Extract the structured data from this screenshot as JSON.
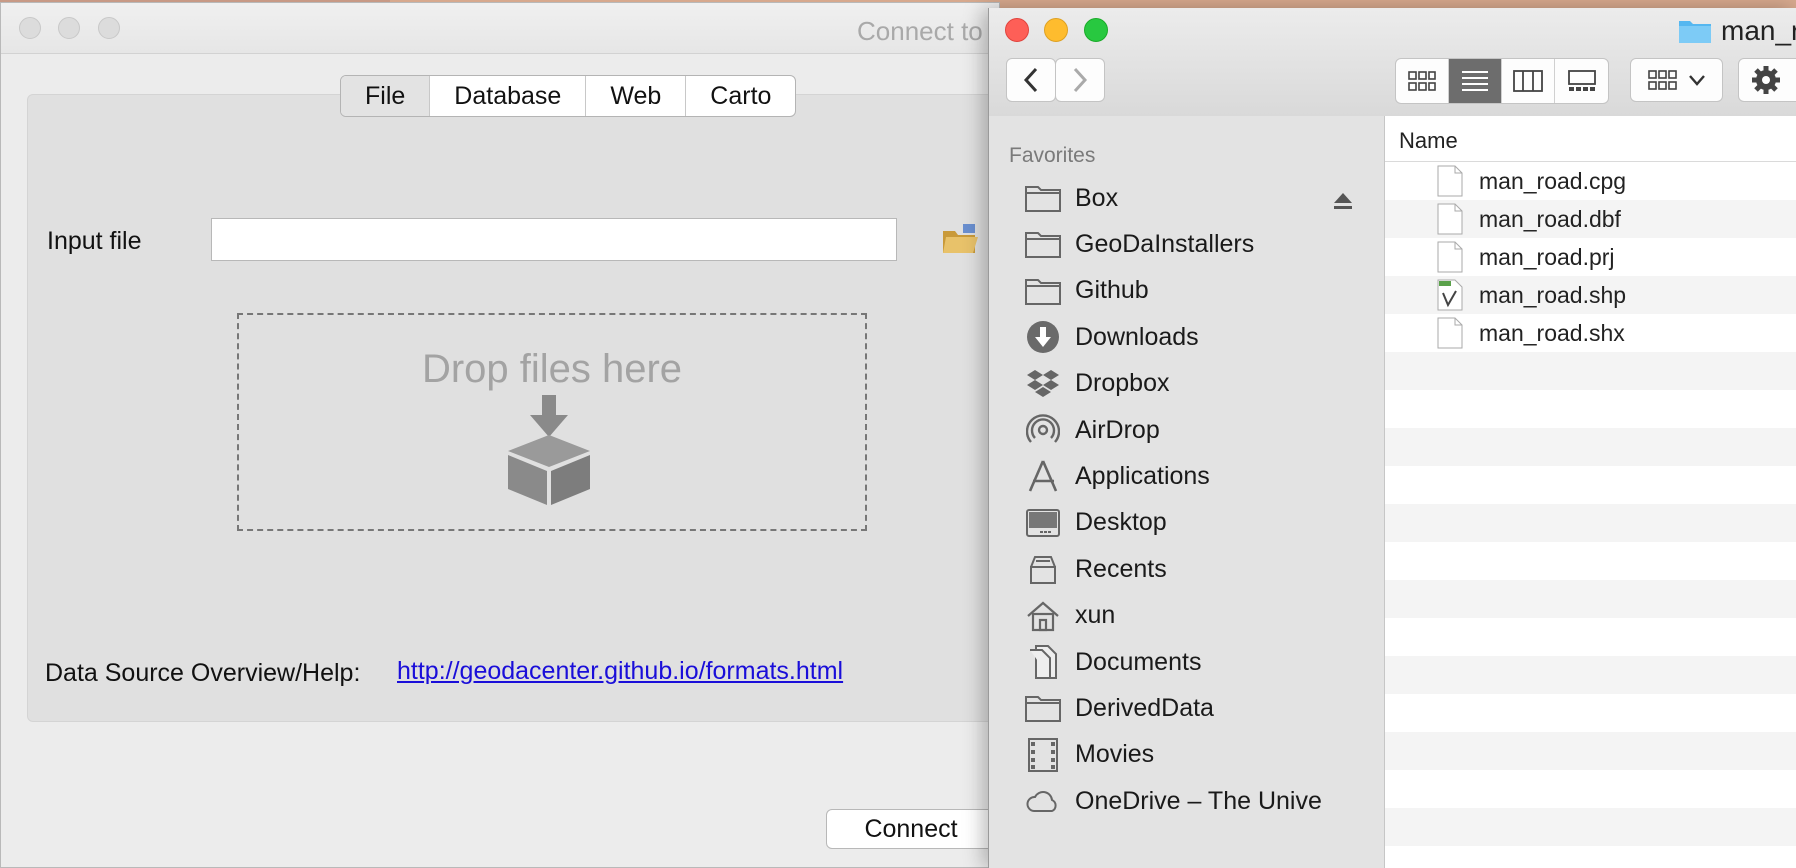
{
  "dialog": {
    "title": "Connect to",
    "tabs": [
      "File",
      "Database",
      "Web",
      "Carto"
    ],
    "input_label": "Input file",
    "input_value": "",
    "drop_text": "Drop files here",
    "help_label": "Data Source Overview/Help:",
    "help_link": "http://geodacenter.github.io/formats.html",
    "connect_label": "Connect"
  },
  "finder": {
    "window_title": "man_ro",
    "favorites_heading": "Favorites",
    "sidebar_items": [
      {
        "label": "Box",
        "icon": "folder-icon"
      },
      {
        "label": "GeoDaInstallers",
        "icon": "folder-icon"
      },
      {
        "label": "Github",
        "icon": "folder-icon"
      },
      {
        "label": "Downloads",
        "icon": "downloads-icon"
      },
      {
        "label": "Dropbox",
        "icon": "dropbox-icon"
      },
      {
        "label": "AirDrop",
        "icon": "airdrop-icon"
      },
      {
        "label": "Applications",
        "icon": "applications-icon"
      },
      {
        "label": "Desktop",
        "icon": "desktop-icon"
      },
      {
        "label": "Recents",
        "icon": "recents-icon"
      },
      {
        "label": "xun",
        "icon": "home-icon"
      },
      {
        "label": "Documents",
        "icon": "documents-icon"
      },
      {
        "label": "DerivedData",
        "icon": "folder-icon"
      },
      {
        "label": "Movies",
        "icon": "movies-icon"
      },
      {
        "label": "OneDrive – The Unive",
        "icon": "cloud-icon"
      }
    ],
    "column_name": "Name",
    "files": [
      "man_road.cpg",
      "man_road.dbf",
      "man_road.prj",
      "man_road.shp",
      "man_road.shx"
    ]
  }
}
